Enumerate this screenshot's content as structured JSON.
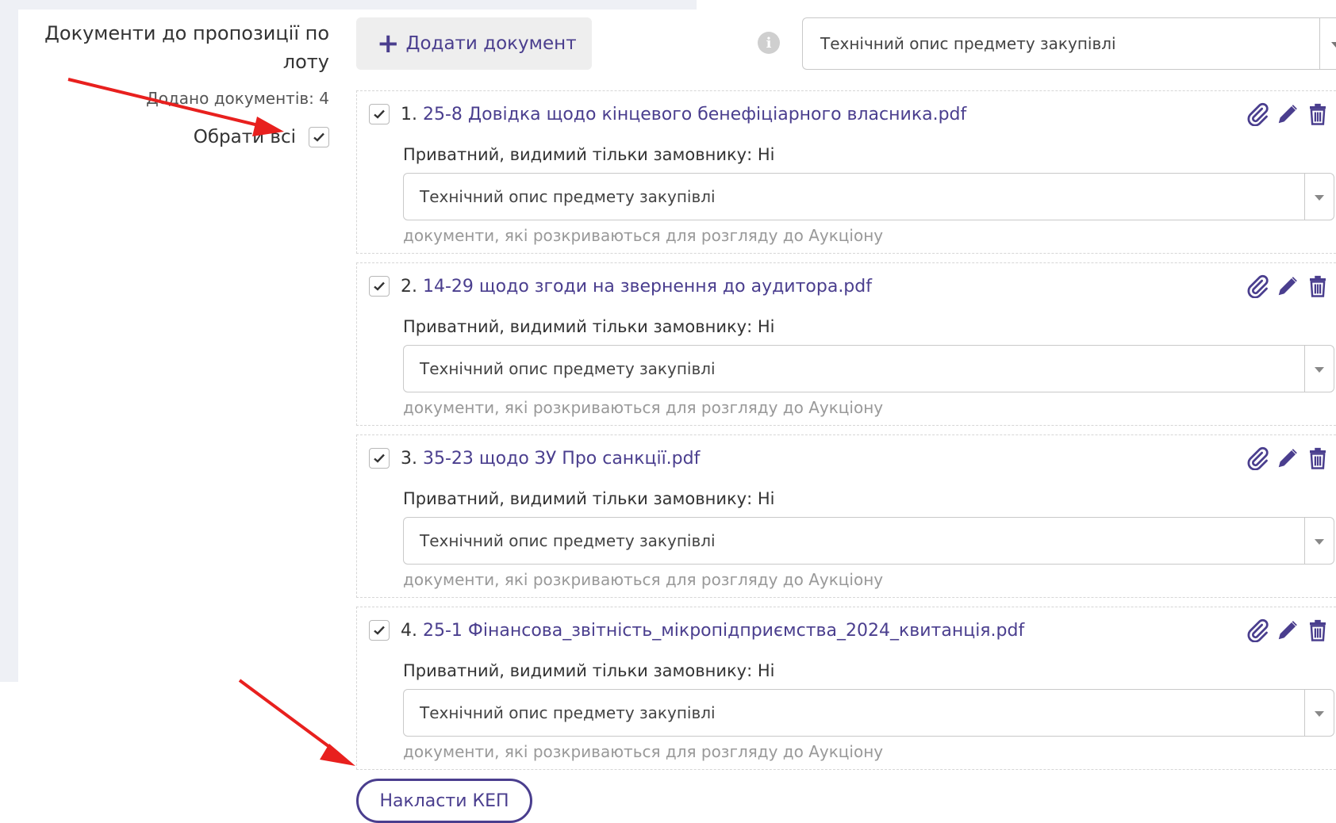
{
  "section": {
    "label": "Документи до пропозиції по лоту",
    "docs_count": "Додано документів: 4",
    "select_all": "Обрати всі"
  },
  "toolbar": {
    "add_document_label": "Додати документ",
    "type_select_value": "Технічний опис предмету закупівлі"
  },
  "documents": [
    {
      "number": "1.",
      "name": "25-8 Довідка щодо кінцевого бенефіціарного власника.pdf",
      "private": "Приватний, видимий тільки замовнику: Ні",
      "type": "Технічний опис предмету закупівлі",
      "hint": "документи, які розкриваються для розгляду до Аукціону"
    },
    {
      "number": "2.",
      "name": "14-29 щодо згоди на звернення до аудитора.pdf",
      "private": "Приватний, видимий тільки замовнику: Ні",
      "type": "Технічний опис предмету закупівлі",
      "hint": "документи, які розкриваються для розгляду до Аукціону"
    },
    {
      "number": "3.",
      "name": "35-23 щодо ЗУ Про санкції.pdf",
      "private": "Приватний, видимий тільки замовнику: Ні",
      "type": "Технічний опис предмету закупівлі",
      "hint": "документи, які розкриваються для розгляду до Аукціону"
    },
    {
      "number": "4.",
      "name": "25-1 Фінансова_звітність_мікропідприємства_2024_квитанція.pdf",
      "private": "Приватний, видимий тільки замовнику: Ні",
      "type": "Технічний опис предмету закупівлі",
      "hint": "документи, які розкриваються для розгляду до Аукціону"
    }
  ],
  "sign_button_label": "Накласти КЕП",
  "colors": {
    "accent": "#4a3e8e",
    "arrow": "#e8201e",
    "hint": "#999999"
  }
}
